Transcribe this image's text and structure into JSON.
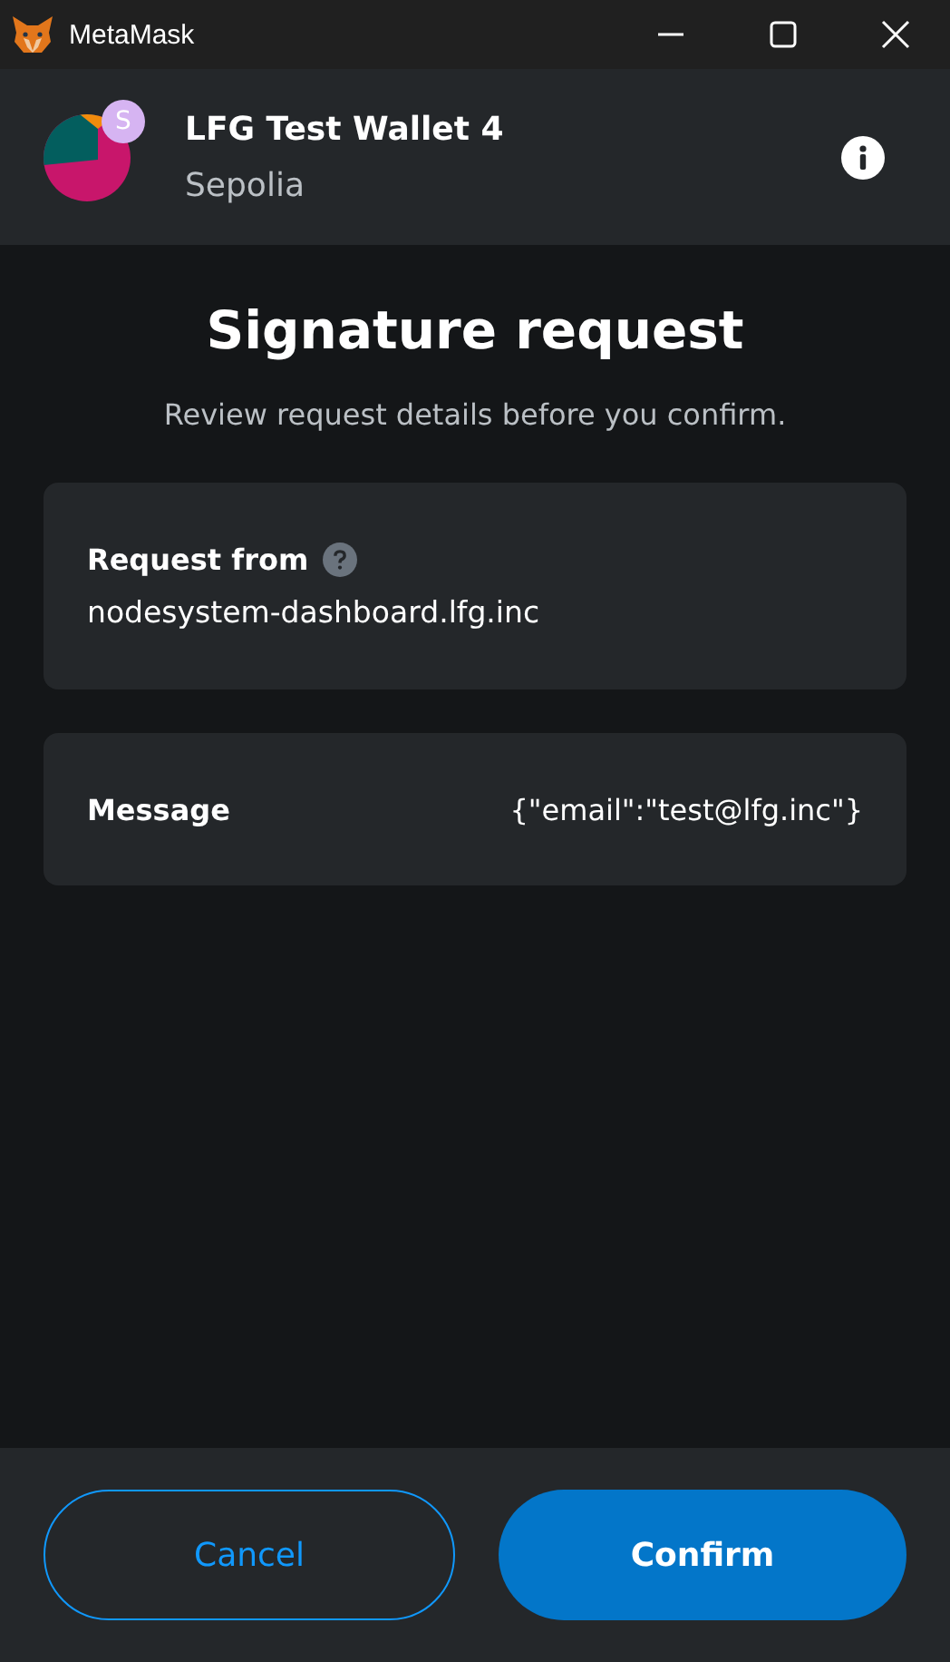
{
  "window": {
    "title": "MetaMask"
  },
  "account": {
    "name": "LFG Test Wallet 4",
    "network": "Sepolia",
    "network_badge": "S"
  },
  "title": "Signature request",
  "subtitle": "Review request details before you confirm.",
  "request": {
    "label": "Request from",
    "origin": "nodesystem-dashboard.lfg.inc"
  },
  "message": {
    "label": "Message",
    "value": "{\"email\":\"test@lfg.inc\"}"
  },
  "buttons": [
    {
      "label": "Cancel",
      "kind": "secondary"
    },
    {
      "label": "Confirm",
      "kind": "primary"
    }
  ]
}
